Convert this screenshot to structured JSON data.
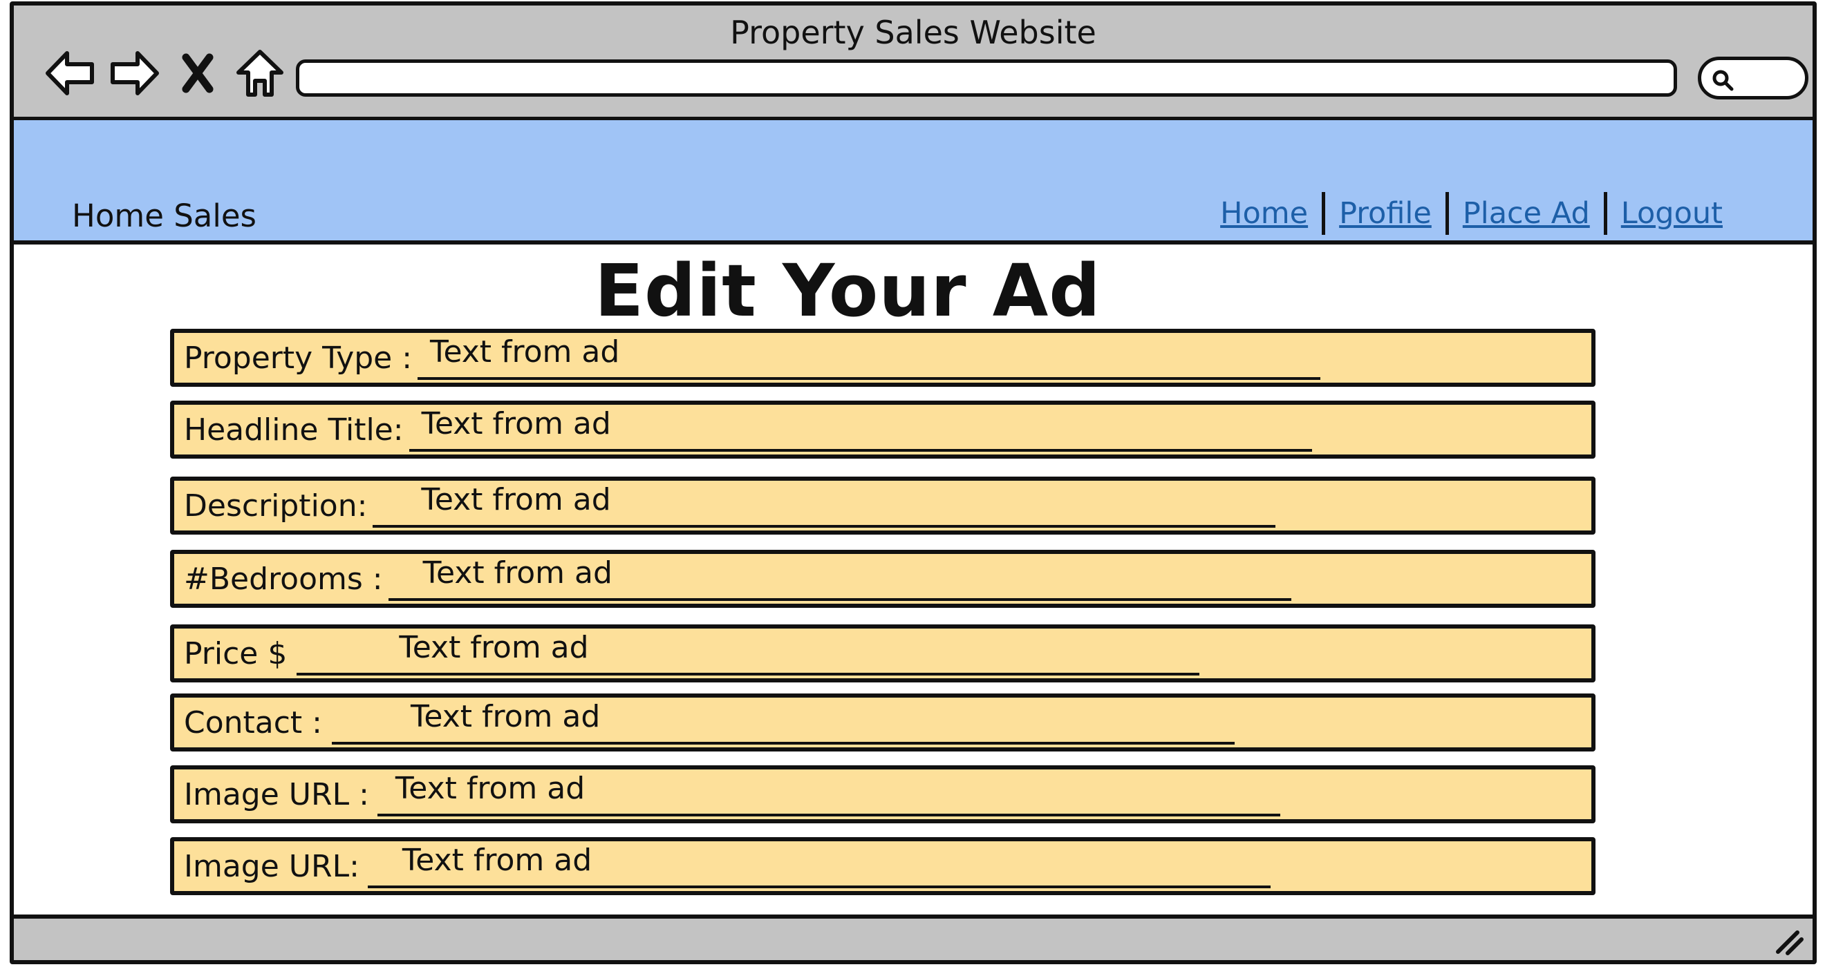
{
  "window": {
    "title": "Property Sales Website"
  },
  "toolbar": {
    "buttons": [
      {
        "name": "back-icon"
      },
      {
        "name": "forward-icon"
      },
      {
        "name": "close-icon"
      },
      {
        "name": "home-icon"
      }
    ],
    "address_value": "",
    "search_icon": "search-icon"
  },
  "header": {
    "brand": "Home Sales",
    "nav": {
      "home": "Home",
      "profile": "Profile",
      "place_ad": "Place Ad",
      "logout": "Logout"
    },
    "colors": {
      "header_bg": "#a0c4f6",
      "link": "#1d5fa8"
    }
  },
  "main": {
    "title": "Edit Your Ad",
    "fields": [
      {
        "label": "Property Type :",
        "value": "Text from ad"
      },
      {
        "label": "Headline Title:",
        "value": "Text from ad"
      },
      {
        "label": "Description:",
        "value": "Text from ad"
      },
      {
        "label": "#Bedrooms :",
        "value": "Text from ad"
      },
      {
        "label": "Price $",
        "value": "Text from ad"
      },
      {
        "label": "Contact :",
        "value": "Text from ad"
      },
      {
        "label": "Image URL :",
        "value": "Text from ad"
      },
      {
        "label": "Image URL:",
        "value": "Text from ad"
      }
    ],
    "colors": {
      "field_bg": "#fde09a"
    }
  }
}
